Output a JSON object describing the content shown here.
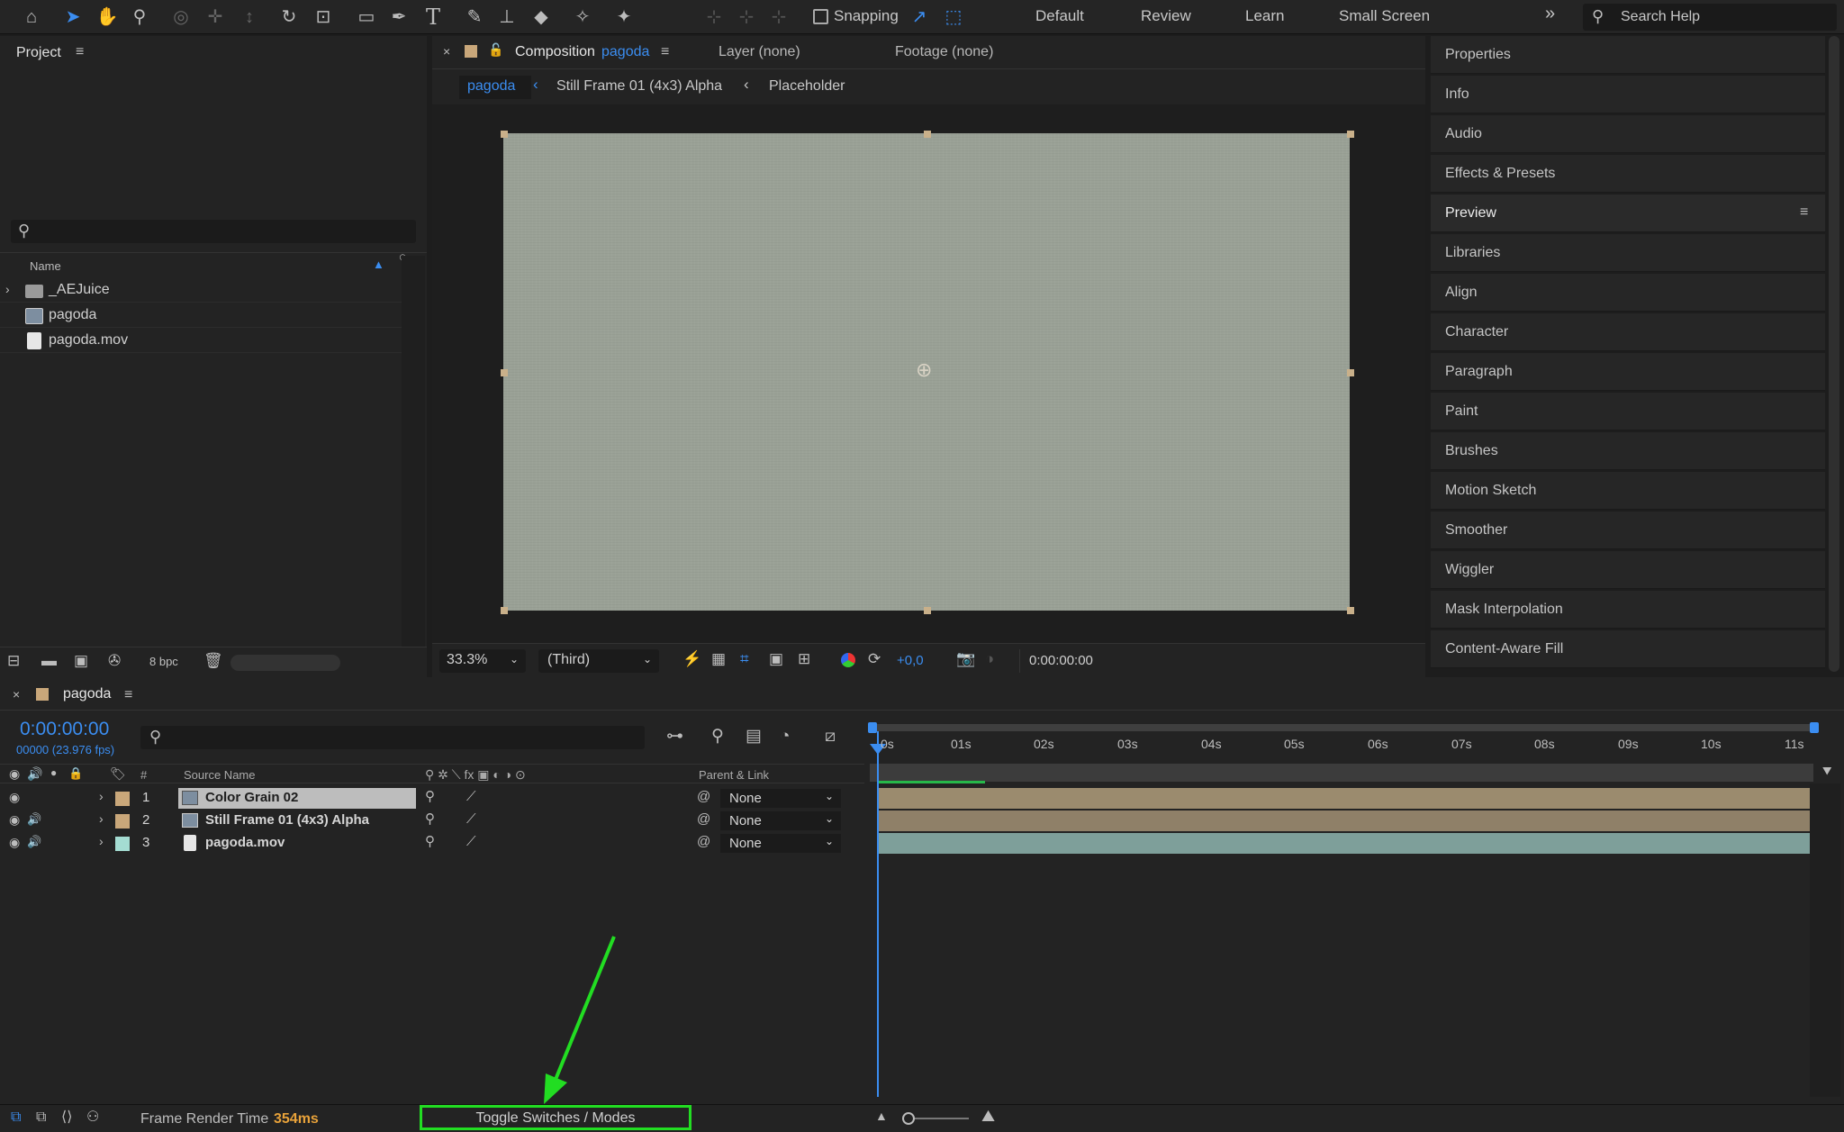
{
  "toolbar": {
    "snapping_label": "Snapping",
    "workspaces": [
      "Default",
      "Review",
      "Learn",
      "Small Screen"
    ],
    "search_placeholder": "Search Help",
    "tool_icons": [
      "home-icon",
      "selection-icon",
      "hand-icon",
      "zoom-icon",
      "orbit-icon",
      "pan-icon",
      "dolly-icon",
      "rotate-icon",
      "pan-behind-icon",
      "rectangle-icon",
      "pen-icon",
      "type-icon",
      "brush-icon",
      "clone-stamp-icon",
      "eraser-icon",
      "roto-brush-icon",
      "puppet-pin-icon"
    ]
  },
  "project": {
    "title": "Project",
    "column_name": "Name",
    "items": [
      {
        "name": "_AEJuice",
        "icon": "folder-icon"
      },
      {
        "name": "pagoda",
        "icon": "composition-icon"
      },
      {
        "name": "pagoda.mov",
        "icon": "footage-icon"
      }
    ],
    "bpc": "8 bpc"
  },
  "composition": {
    "tab_prefix": "Composition",
    "tab_name": "pagoda",
    "layer_tab": "Layer (none)",
    "footage_tab": "Footage (none)",
    "breadcrumbs": [
      "pagoda",
      "Still Frame 01 (4x3) Alpha",
      "Placeholder"
    ],
    "zoom": "33.3%",
    "resolution": "(Third)",
    "exposure": "+0,0",
    "timecode": "0:00:00:00"
  },
  "right_panel": {
    "items": [
      "Properties",
      "Info",
      "Audio",
      "Effects & Presets",
      "Preview",
      "Libraries",
      "Align",
      "Character",
      "Paragraph",
      "Paint",
      "Brushes",
      "Motion Sketch",
      "Smoother",
      "Wiggler",
      "Mask Interpolation",
      "Content-Aware Fill"
    ]
  },
  "timeline": {
    "comp_name": "pagoda",
    "timecode": "0:00:00:00",
    "fps": "00000 (23.976 fps)",
    "col_source": "Source Name",
    "col_parent": "Parent & Link",
    "col_num": "#",
    "ticks": [
      "0s",
      "01s",
      "02s",
      "03s",
      "04s",
      "05s",
      "06s",
      "07s",
      "08s",
      "09s",
      "10s",
      "11s"
    ],
    "layers": [
      {
        "num": "1",
        "name": "Color Grain 02",
        "parent": "None",
        "color": "#c9a77a"
      },
      {
        "num": "2",
        "name": "Still Frame 01 (4x3) Alpha",
        "parent": "None",
        "color": "#c9a77a"
      },
      {
        "num": "3",
        "name": "pagoda.mov",
        "parent": "None",
        "color": "#a4dcd2"
      }
    ]
  },
  "status": {
    "render_label": "Frame Render Time",
    "render_value": "354ms",
    "toggle_label": "Toggle Switches / Modes"
  },
  "colors": {
    "accent": "#2d8ceb",
    "annotation": "#22dd22",
    "render_value": "#e8a23a"
  }
}
